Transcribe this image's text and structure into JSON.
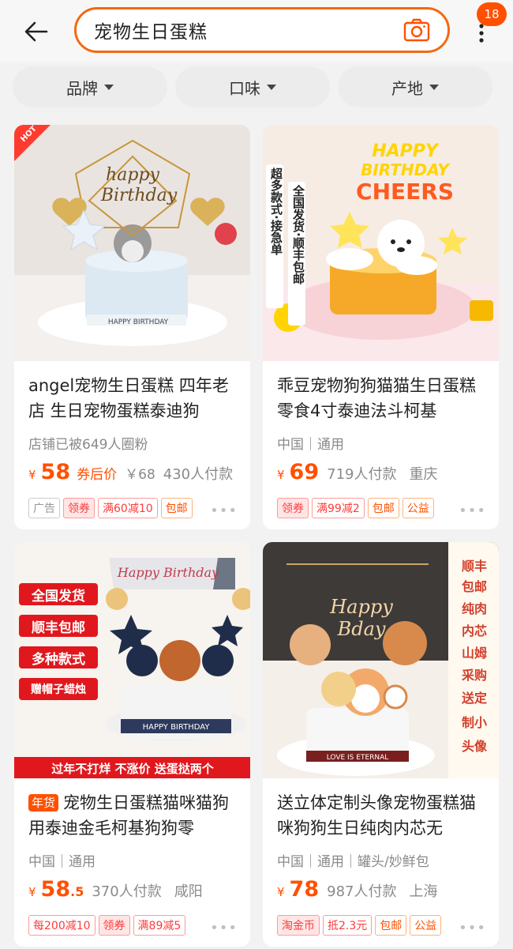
{
  "search": {
    "query": "宠物生日蛋糕"
  },
  "header": {
    "badge_count": "18"
  },
  "filters": [
    {
      "label": "品牌"
    },
    {
      "label": "口味"
    },
    {
      "label": "产地"
    }
  ],
  "products": [
    {
      "title": "angel宠物生日蛋糕 四年老店 生日宠物蛋糕泰迪狗",
      "meta": "店铺已被649人圈粉",
      "price": "58",
      "price_suffix": "券后价",
      "original_price": "￥68",
      "sold": "430人付款",
      "city": "",
      "tags": [
        "广告",
        "领券",
        "满60减10",
        "包邮"
      ],
      "image_badge": "HOT",
      "image_text": [
        "happy",
        "Birthday",
        "HAPPY BIRTHDAY"
      ]
    },
    {
      "title": "乖豆宠物狗狗猫猫生日蛋糕零食4寸泰迪法斗柯基",
      "meta": "中国｜通用",
      "price": "69",
      "sold": "719人付款",
      "city": "重庆",
      "tags": [
        "领券",
        "满99减2",
        "包邮",
        "公益"
      ],
      "image_text": [
        "HAPPY",
        "BIRTHDAY",
        "CHEERS",
        "超多款式·接急单",
        "全国发货·顺丰包邮"
      ]
    },
    {
      "title_prefix": "年货",
      "title": "宠物生日蛋糕猫咪猫狗用泰迪金毛柯基狗狗零",
      "meta": "中国｜通用",
      "price": "58",
      "price_decimal": ".5",
      "sold": "370人付款",
      "city": "咸阳",
      "tags": [
        "每200减10",
        "领券",
        "满89减5"
      ],
      "image_text": [
        "Happy Birthday",
        "全国发货",
        "顺丰包邮",
        "多种款式",
        "赠帽子蜡烛",
        "HAPPY BIRTHDAY",
        "过年不打烊 不涨价 送蛋挞两个"
      ]
    },
    {
      "title": "送立体定制头像宠物蛋糕猫咪狗狗生日纯肉内芯无",
      "meta": "中国｜通用｜罐头/妙鲜包",
      "price": "78",
      "sold": "987人付款",
      "city": "上海",
      "tags": [
        "淘金币",
        "抵2.3元",
        "包邮",
        "公益"
      ],
      "image_text": [
        "Happy",
        "Bday",
        "LOVE IS ETERNAL",
        "顺丰",
        "包邮",
        "纯肉",
        "内芯",
        "山姆",
        "采购",
        "送定",
        "制小",
        "头像"
      ]
    }
  ],
  "colors": {
    "accent": "#ff5000",
    "search_border": "#f26a12"
  }
}
